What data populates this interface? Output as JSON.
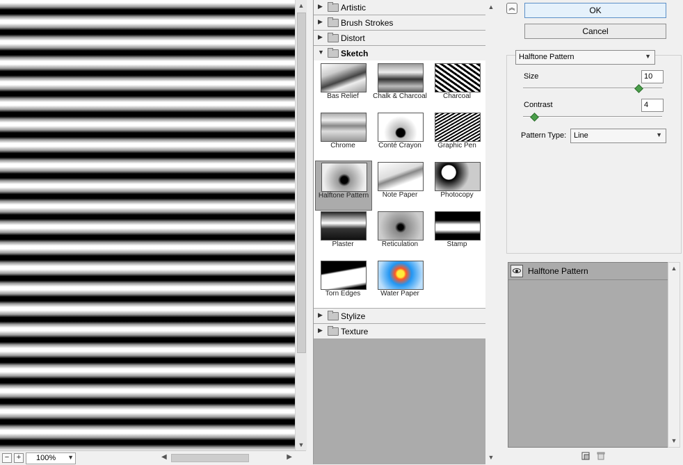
{
  "preview": {
    "zoom": "100%",
    "zoom_out_icon": "minus-icon",
    "zoom_in_icon": "plus-icon"
  },
  "gallery": {
    "categories_top": [
      {
        "label": "Artistic",
        "open": false
      },
      {
        "label": "Brush Strokes",
        "open": false
      },
      {
        "label": "Distort",
        "open": false
      },
      {
        "label": "Sketch",
        "open": true
      }
    ],
    "categories_bottom": [
      {
        "label": "Stylize",
        "open": false
      },
      {
        "label": "Texture",
        "open": false
      }
    ],
    "sketch_filters": [
      "Bas Relief",
      "Chalk & Charcoal",
      "Charcoal",
      "Chrome",
      "Conté Crayon",
      "Graphic Pen",
      "Halftone Pattern",
      "Note Paper",
      "Photocopy",
      "Plaster",
      "Reticulation",
      "Stamp",
      "Torn Edges",
      "Water Paper"
    ],
    "selected_filter": "Halftone Pattern"
  },
  "actions": {
    "ok_label": "OK",
    "cancel_label": "Cancel"
  },
  "settings": {
    "filter_select": "Halftone Pattern",
    "size_label": "Size",
    "size_value": "10",
    "size_fraction": 0.83,
    "contrast_label": "Contrast",
    "contrast_value": "4",
    "contrast_fraction": 0.08,
    "pattern_type_label": "Pattern Type:",
    "pattern_type_value": "Line"
  },
  "layers": {
    "items": [
      {
        "name": "Halftone Pattern",
        "visible": true
      }
    ],
    "new_layer_icon": "new-layer-icon",
    "delete_layer_icon": "trash-icon"
  },
  "colors": {
    "accent": "#5b8fc7",
    "gallery_bg": "#ababab",
    "slider_knob": "#4a9e4a"
  }
}
